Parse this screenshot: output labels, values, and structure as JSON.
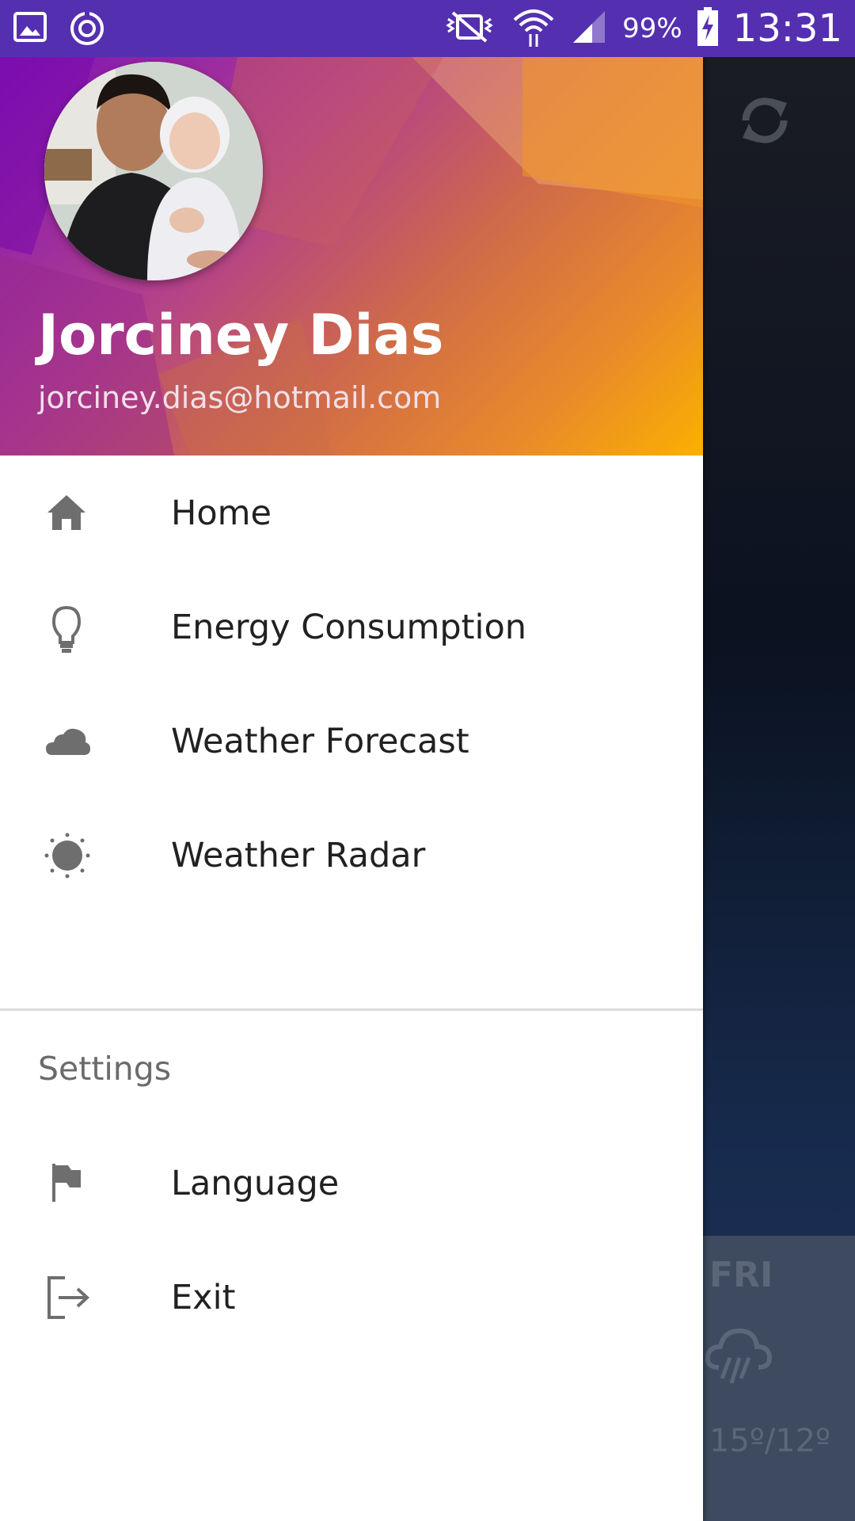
{
  "status_bar": {
    "battery_percent": "99%",
    "time": "13:31",
    "left_icons": [
      "gallery-icon",
      "sync-circle-icon"
    ],
    "right_icons": [
      "vibrate-off-icon",
      "wifi-icon",
      "signal-icon",
      "battery-charging-icon"
    ]
  },
  "drawer": {
    "header": {
      "user_name": "Jorciney Dias",
      "user_email": "jorciney.dias@hotmail.com"
    },
    "items": [
      {
        "label": "Home",
        "icon": "home-icon"
      },
      {
        "label": "Energy Consumption",
        "icon": "lightbulb-icon"
      },
      {
        "label": "Weather Forecast",
        "icon": "cloud-icon"
      },
      {
        "label": "Weather Radar",
        "icon": "sun-icon"
      }
    ],
    "settings_label": "Settings",
    "settings_items": [
      {
        "label": "Language",
        "icon": "flag-icon"
      },
      {
        "label": "Exit",
        "icon": "exit-icon"
      }
    ]
  },
  "background": {
    "forecast_day": "FRI",
    "forecast_temp": "15º/12º",
    "forecast_icon": "rain-cloud-icon",
    "refresh_icon": "sync-icon"
  },
  "colors": {
    "status_bar": "#5430b0",
    "header_start": "#7f12b8",
    "header_end": "#fbb000",
    "icon_gray": "#6e6e6e"
  }
}
